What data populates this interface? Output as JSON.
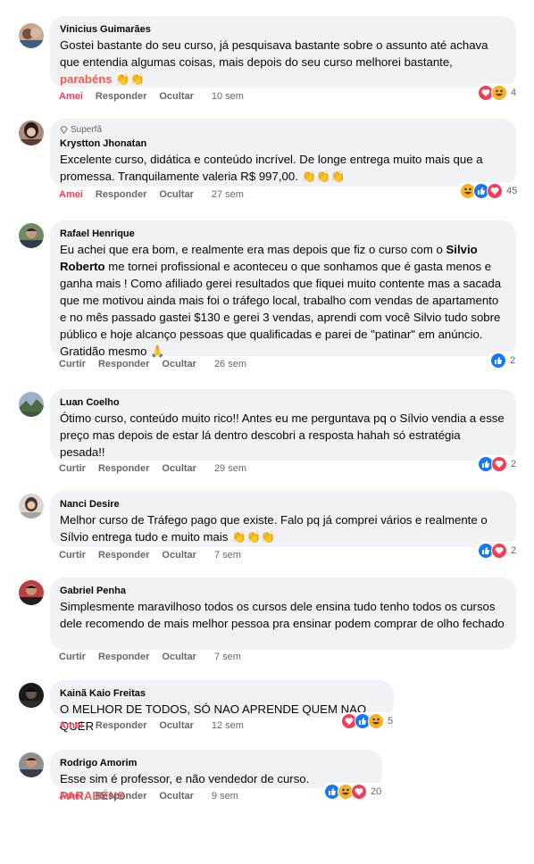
{
  "actions": {
    "like": "Curtir",
    "liked": "Amei",
    "reply": "Responder",
    "hide": "Ocultar"
  },
  "comments": [
    {
      "author": "Vinicius Guimarães",
      "text_parts": [
        "Gostei bastante do seu curso, já pesquisava bastante sobre o assunto até achava que entendia algumas coisas, mais depois do seu curso melhorei bastante, ",
        "parabéns",
        " 👏👏"
      ],
      "time": "10 sem",
      "reactions": [
        "love",
        "haha"
      ],
      "count": "4",
      "liked": true
    },
    {
      "badge": "Superfã",
      "author": "Krystton Jhonatan",
      "text_parts": [
        "Excelente curso, didática e conteúdo incrível. De longe entrega muito mais que a promessa. Tranquilamente valeria R$ 997,00. 👏👏👏"
      ],
      "time": "27 sem",
      "reactions": [
        "haha",
        "like",
        "love"
      ],
      "count": "45",
      "liked": true
    },
    {
      "author": "Rafael Henrique",
      "text_parts": [
        "Eu achei que era bom, e realmente era mas depois que fiz o curso com o ",
        "Silvio Roberto",
        " me tornei profissional e aconteceu o que sonhamos que é gasta menos e ganha mais ! Como afiliado gerei resultados que fiquei muito contente mas a sacada que me motivou ainda mais foi o tráfego local, trabalho com vendas de apartamento e no mês passado gastei $130 e gerei 3 vendas, aprendi com você Silvio tudo sobre público e hoje alcanço pessoas que qualificadas e parei de \"patinar\" em anúncio. Gratidão mesmo 🙏"
      ],
      "time": "26 sem",
      "reactions": [
        "like"
      ],
      "count": "2",
      "liked": false
    },
    {
      "author": "Luan Coelho",
      "text_parts": [
        "Ótimo curso, conteúdo muito rico!! Antes eu me perguntava pq o Sílvio vendia a esse preço mas depois de estar lá dentro descobri a resposta hahah só estratégia pesada!!"
      ],
      "time": "29 sem",
      "reactions": [
        "like",
        "love"
      ],
      "count": "2",
      "liked": false
    },
    {
      "author": "Nanci Desire",
      "text_parts": [
        "Melhor curso de Tráfego pago que existe. Falo pq já comprei vários e realmente o Sílvio entrega tudo e muito mais 👏👏👏"
      ],
      "time": "7 sem",
      "reactions": [
        "like",
        "love"
      ],
      "count": "2",
      "liked": false
    },
    {
      "author": "Gabriel Penha",
      "text_parts": [
        "Simplesmente maravilhoso todos os cursos dele ensina tudo tenho todos os cursos dele recomendo de mais melhor pessoa pra ensinar podem comprar de olho fechado"
      ],
      "time": "7 sem",
      "reactions": [],
      "count": "",
      "liked": false
    },
    {
      "author": "Kainã Kaio Freitas",
      "text_parts": [
        "O MELHOR DE TODOS, SÓ NAO APRENDE QUEM NAO QUER"
      ],
      "time": "12 sem",
      "reactions": [
        "love",
        "like",
        "haha"
      ],
      "count": "5",
      "liked": true
    },
    {
      "author": "Rodrigo Amorim",
      "text_parts": [
        "Esse sim é professor, e não vendedor de curso. ",
        "PARABÉNS"
      ],
      "time": "9 sem",
      "reactions": [
        "like",
        "haha",
        "love"
      ],
      "count": "20",
      "liked": true
    }
  ]
}
